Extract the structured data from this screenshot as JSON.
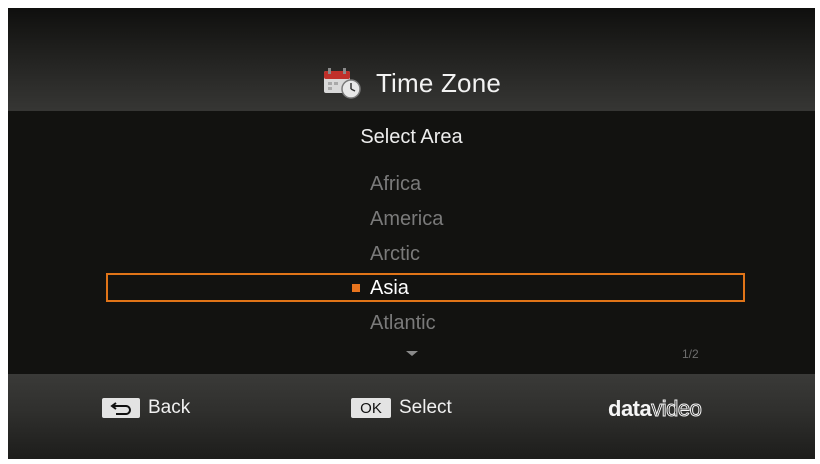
{
  "header": {
    "title": "Time Zone",
    "icon": "calendar-clock-icon"
  },
  "main": {
    "section_title": "Select Area",
    "items": [
      {
        "label": "Africa"
      },
      {
        "label": "America"
      },
      {
        "label": "Arctic"
      },
      {
        "label": "Asia",
        "selected": true
      },
      {
        "label": "Atlantic"
      }
    ],
    "page_indicator": "1/2",
    "highlight_color": "#e07418"
  },
  "footer": {
    "back_label": "Back",
    "ok_key": "OK",
    "select_label": "Select",
    "logo": {
      "bold": "data",
      "light": "video"
    }
  }
}
